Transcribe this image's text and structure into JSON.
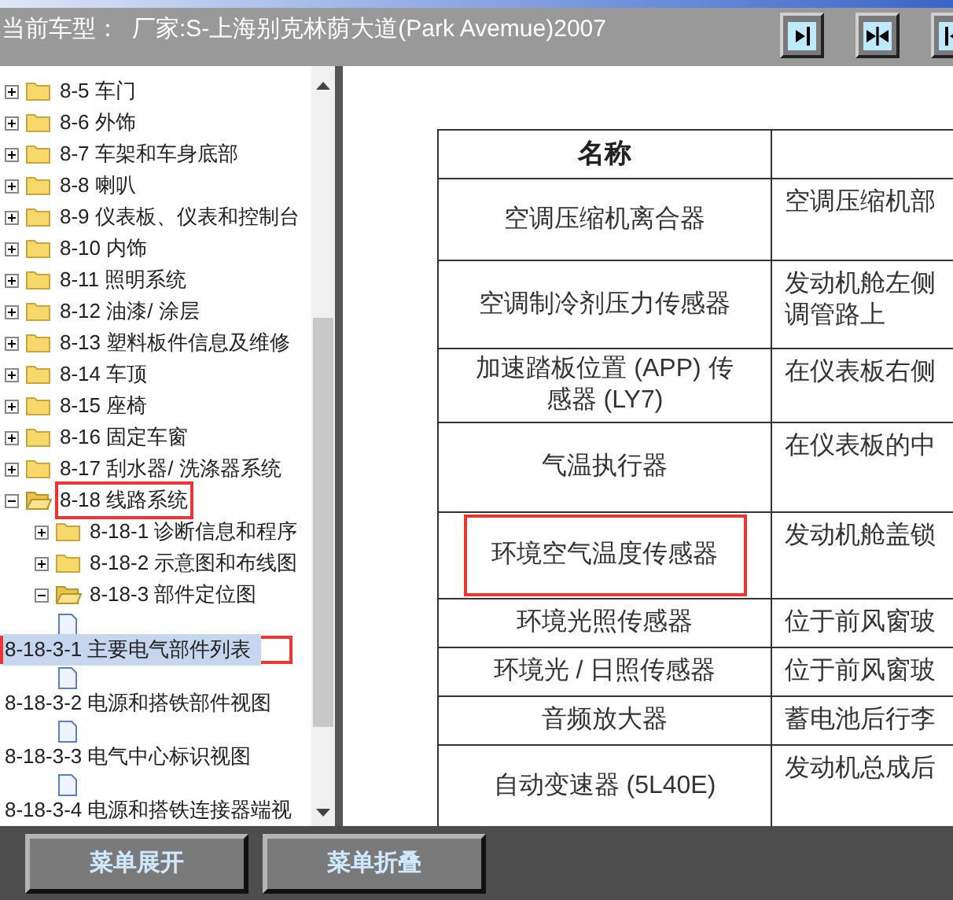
{
  "header": {
    "model_label": "当前车型：",
    "model_value": "厂家:S-上海别克林荫大道(Park Avemue)2007"
  },
  "tree": [
    {
      "kind": "folder",
      "label": "8-5 车门",
      "expanded": false
    },
    {
      "kind": "folder",
      "label": "8-6 外饰",
      "expanded": false
    },
    {
      "kind": "folder",
      "label": "8-7 车架和车身底部",
      "expanded": false
    },
    {
      "kind": "folder",
      "label": "8-8 喇叭",
      "expanded": false
    },
    {
      "kind": "folder",
      "label": "8-9 仪表板、仪表和控制台",
      "expanded": false
    },
    {
      "kind": "folder",
      "label": "8-10 内饰",
      "expanded": false
    },
    {
      "kind": "folder",
      "label": "8-11 照明系统",
      "expanded": false
    },
    {
      "kind": "folder",
      "label": "8-12 油漆/ 涂层",
      "expanded": false
    },
    {
      "kind": "folder",
      "label": "8-13 塑料板件信息及维修",
      "expanded": false
    },
    {
      "kind": "folder",
      "label": "8-14 车顶",
      "expanded": false
    },
    {
      "kind": "folder",
      "label": "8-15 座椅",
      "expanded": false
    },
    {
      "kind": "folder",
      "label": "8-16 固定车窗",
      "expanded": false
    },
    {
      "kind": "folder",
      "label": "8-17 刮水器/ 洗涤器系统",
      "expanded": false
    },
    {
      "kind": "folder",
      "label": "8-18 线路系统",
      "expanded": true,
      "annotated": true,
      "children": [
        {
          "kind": "folder",
          "label": "8-18-1 诊断信息和程序",
          "expanded": false
        },
        {
          "kind": "folder",
          "label": "8-18-2 示意图和布线图",
          "expanded": false
        },
        {
          "kind": "folder",
          "label": "8-18-3 部件定位图",
          "expanded": true,
          "children": [
            {
              "kind": "page",
              "label": "8-18-3-1 主要电气部件列表",
              "selected": true,
              "annotated": true
            },
            {
              "kind": "page",
              "label": "8-18-3-2 电源和搭铁部件视图",
              "selected": false,
              "annotated": false
            },
            {
              "kind": "page",
              "label": "8-18-3-3 电气中心标识视图",
              "selected": false,
              "annotated": false
            },
            {
              "kind": "page",
              "label": "8-18-3-4 电源和搭铁连接器端视",
              "selected": false,
              "annotated": false
            }
          ]
        }
      ]
    }
  ],
  "table": {
    "columns": [
      "名称",
      ""
    ],
    "rows": [
      {
        "cells": [
          "空调压缩机离合器",
          "空调压缩机部"
        ],
        "annotated": false
      },
      {
        "cells": [
          "空调制冷剂压力传感器",
          "发动机舱左侧调管路上"
        ],
        "annotated": false
      },
      {
        "cells": [
          "加速踏板位置 (APP) 传感器 (LY7)",
          "在仪表板右侧"
        ],
        "annotated": false
      },
      {
        "cells": [
          "气温执行器",
          "在仪表板的中"
        ],
        "annotated": false
      },
      {
        "cells": [
          "环境空气温度传感器",
          "发动机舱盖锁"
        ],
        "annotated": true
      },
      {
        "cells": [
          "环境光照传感器",
          "位于前风窗玻"
        ],
        "annotated": false
      },
      {
        "cells": [
          "环境光 / 日照传感器",
          "位于前风窗玻"
        ],
        "annotated": false
      },
      {
        "cells": [
          "音频放大器",
          "蓄电池后行李"
        ],
        "annotated": false
      },
      {
        "cells": [
          "自动变速器 (5L40E)",
          "发动机总成后"
        ],
        "annotated": false
      }
    ]
  },
  "buttons": [
    "菜单展开",
    "菜单折叠"
  ]
}
